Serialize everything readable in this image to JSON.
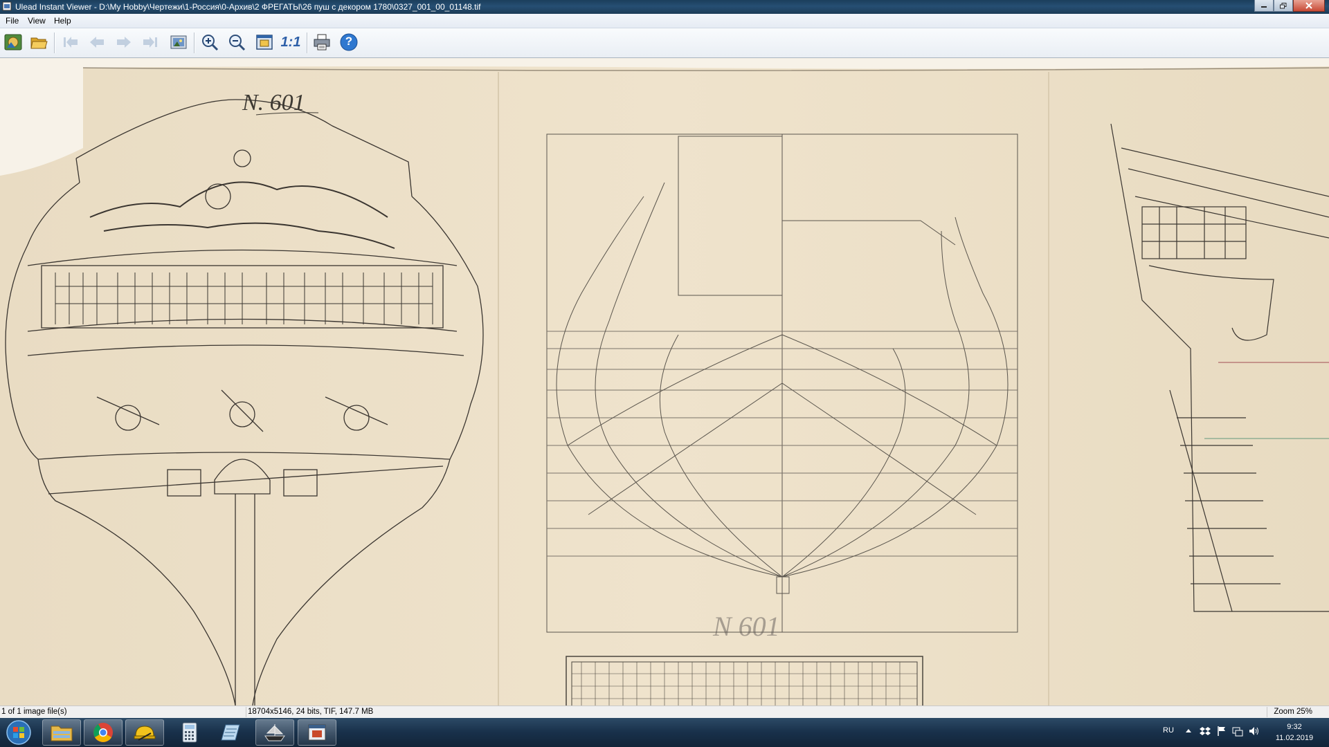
{
  "window": {
    "title": "Ulead Instant Viewer - D:\\My Hobby\\Чертежи\\1-Россия\\0-Архив\\2 ФРЕГАТЫ\\26 пуш с декором 1780\\0327_001_00_01148.tif"
  },
  "menu": [
    "File",
    "View",
    "Help"
  ],
  "toolbar": {
    "buttons": [
      {
        "name": "browse-icon",
        "enabled": true
      },
      {
        "name": "open-folder-icon",
        "enabled": true
      },
      {
        "name": "first-image-icon",
        "enabled": false
      },
      {
        "name": "previous-image-icon",
        "enabled": false
      },
      {
        "name": "next-image-icon",
        "enabled": false
      },
      {
        "name": "last-image-icon",
        "enabled": false
      },
      {
        "name": "slideshow-icon",
        "enabled": true
      },
      {
        "name": "zoom-in-icon",
        "enabled": true
      },
      {
        "name": "zoom-out-icon",
        "enabled": true
      },
      {
        "name": "fit-to-window-icon",
        "enabled": true
      },
      {
        "name": "actual-size-icon",
        "enabled": true,
        "label": "1:1"
      },
      {
        "name": "print-icon",
        "enabled": true
      },
      {
        "name": "help-icon",
        "enabled": true,
        "label": "?"
      }
    ]
  },
  "image": {
    "annotation_top": "N. 601",
    "annotation_bottom": "N 601"
  },
  "status": {
    "count": "1 of 1 image file(s)",
    "info": "18704x5146, 24 bits, TIF, 147.7 MB",
    "zoom": "Zoom 25%"
  },
  "taskbar": {
    "items": [
      {
        "name": "start-button",
        "icon": "windows-orb-icon"
      },
      {
        "name": "explorer-button",
        "icon": "folder-icon"
      },
      {
        "name": "chrome-button",
        "icon": "chrome-icon"
      },
      {
        "name": "app-button",
        "icon": "hardhat-icon"
      },
      {
        "name": "calculator-button",
        "icon": "calculator-icon"
      },
      {
        "name": "notes-button",
        "icon": "notes-icon"
      },
      {
        "name": "ship-app-button",
        "icon": "ship-icon"
      },
      {
        "name": "viewer-button",
        "icon": "viewer-icon",
        "active": true
      }
    ],
    "language": "RU",
    "time": "9:32",
    "date": "11.02.2019"
  }
}
